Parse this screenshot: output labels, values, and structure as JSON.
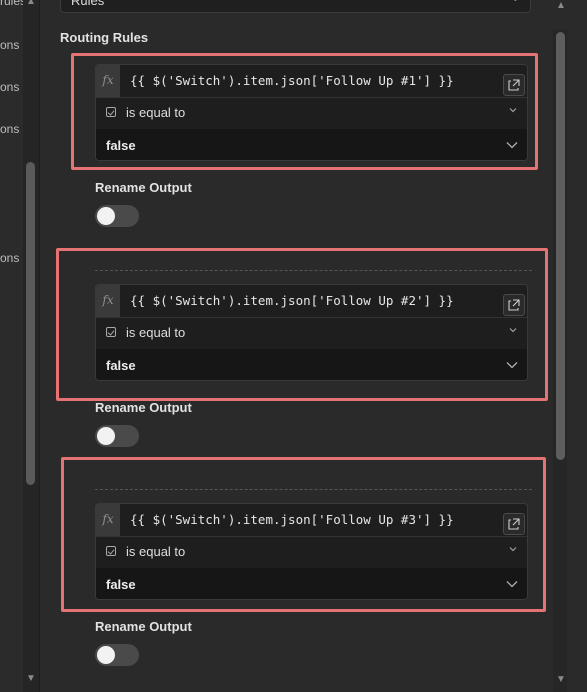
{
  "left_panel": {
    "fragments": [
      "rules",
      "ons",
      "ons",
      "ons",
      "ons"
    ]
  },
  "mode_select": {
    "value": "Rules"
  },
  "routing_rules": {
    "label": "Routing Rules",
    "rules": [
      {
        "fx_label": "fx",
        "expression": "{{ $('Switch').item.json['Follow Up #1'] }}",
        "operator": "is equal to",
        "value": "false",
        "rename_output_label": "Rename Output",
        "rename_output_enabled": false
      },
      {
        "fx_label": "fx",
        "expression": "{{ $('Switch').item.json['Follow Up #2'] }}",
        "operator": "is equal to",
        "value": "false",
        "rename_output_label": "Rename Output",
        "rename_output_enabled": false
      },
      {
        "fx_label": "fx",
        "expression": "{{ $('Switch').item.json['Follow Up #3'] }}",
        "operator": "is equal to",
        "value": "false",
        "rename_output_label": "Rename Output",
        "rename_output_enabled": false
      }
    ]
  },
  "colors": {
    "highlight": "#e57373",
    "background": "#2a2a2a",
    "input_background": "#1e1e1e"
  }
}
